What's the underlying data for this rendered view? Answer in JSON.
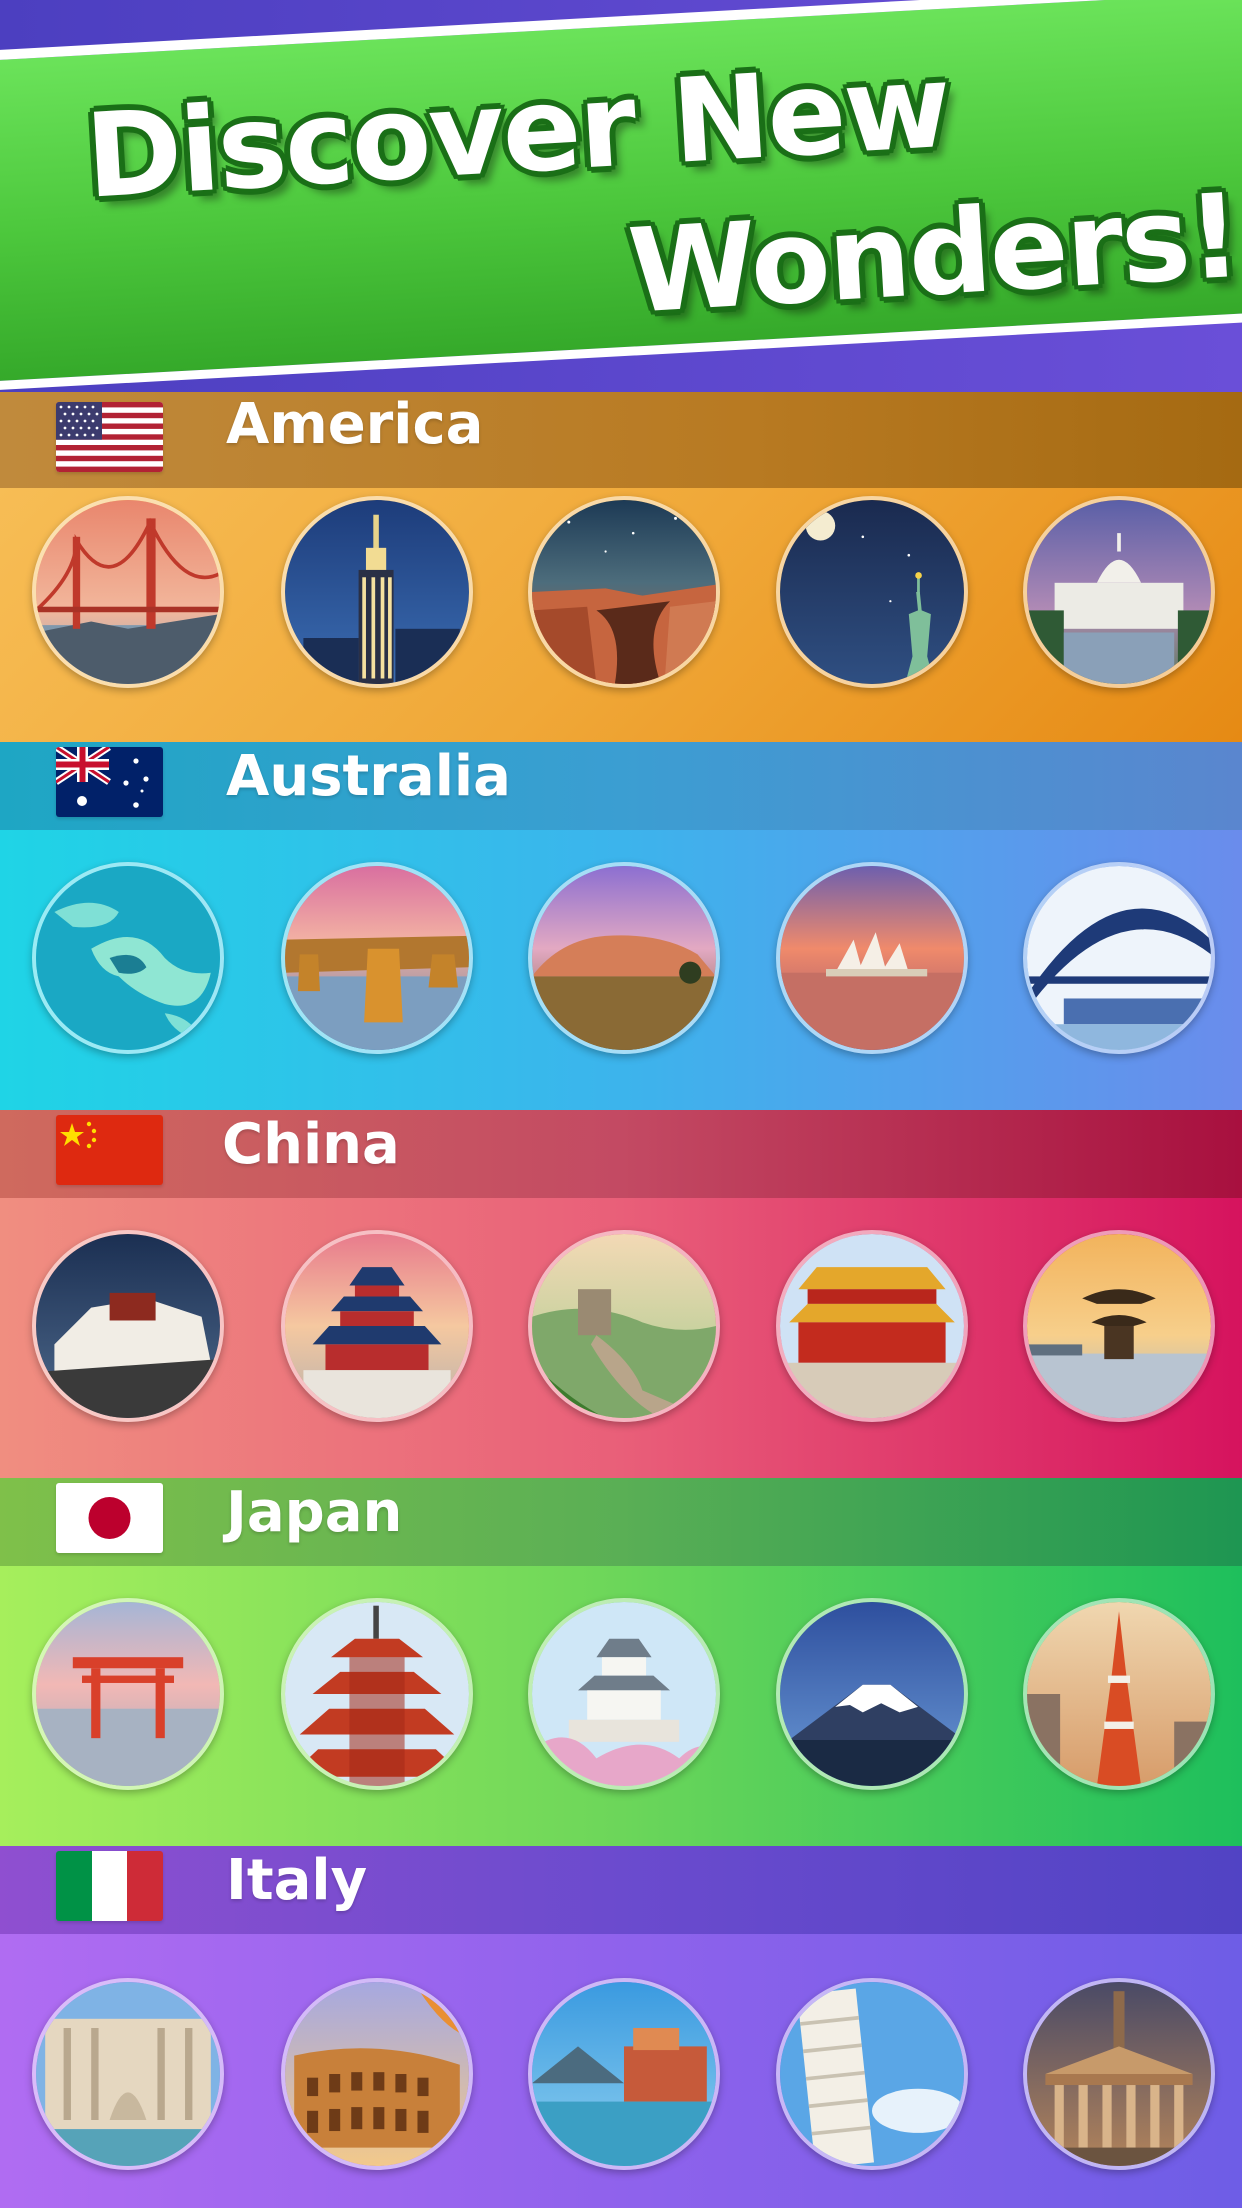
{
  "banner": {
    "line1": "Discover New",
    "line2": "Wonders!"
  },
  "sections": [
    {
      "name": "America",
      "flag": "us-flag",
      "wonders": [
        "golden-gate-bridge",
        "empire-state-building",
        "grand-canyon",
        "statue-of-liberty",
        "us-capitol"
      ]
    },
    {
      "name": "Australia",
      "flag": "australia-flag",
      "wonders": [
        "great-barrier-reef",
        "twelve-apostles",
        "uluru",
        "sydney-opera-house",
        "sydney-harbour-bridge"
      ]
    },
    {
      "name": "China",
      "flag": "china-flag",
      "wonders": [
        "potala-palace",
        "temple-of-heaven",
        "great-wall",
        "forbidden-city",
        "lake-pavilion"
      ]
    },
    {
      "name": "Japan",
      "flag": "japan-flag",
      "wonders": [
        "itsukushima-torii",
        "red-pagoda",
        "himeji-castle",
        "mount-fuji",
        "tokyo-tower"
      ]
    },
    {
      "name": "Italy",
      "flag": "italy-flag",
      "wonders": [
        "trevi-fountain",
        "colosseum",
        "lake-village",
        "leaning-tower-of-pisa",
        "pantheon"
      ]
    }
  ],
  "colors": {
    "america_header": "#b97f2a",
    "america_body": "#f0a938",
    "australia_header": "#2f9ed9",
    "australia_body": "#3bc4e6",
    "china_header": "#b8465f",
    "china_body": "#e65c7a",
    "japan_header": "#4fb04a",
    "japan_body": "#6cd15a",
    "italy_header": "#6f49cf",
    "italy_body": "#8b5ce6",
    "banner_green": "#4cc73c"
  }
}
